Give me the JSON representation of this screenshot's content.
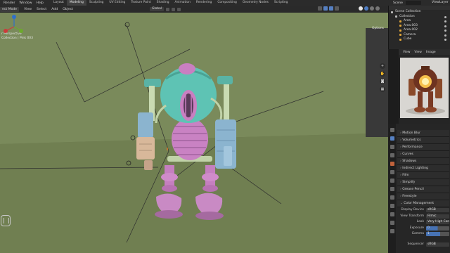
{
  "menu": {
    "items": [
      "Render",
      "Window",
      "Help"
    ],
    "workspace_tabs": [
      "Layout",
      "Modeling",
      "Sculpting",
      "UV Editing",
      "Texture Paint",
      "Shading",
      "Animation",
      "Rendering",
      "Compositing",
      "Geometry Nodes",
      "Scripting"
    ],
    "active_tab": "Modeling",
    "scene_label": "Scene",
    "view_layer_label": "ViewLayer"
  },
  "viewport_header": {
    "mode": "ect Mode",
    "menus": [
      "View",
      "Select",
      "Add",
      "Object"
    ],
    "orientation": "Global",
    "options_label": "Options"
  },
  "viewport_info": {
    "line1": "r Perspective",
    "line2": "Collection | Pink 003"
  },
  "outliner": {
    "rows": [
      {
        "label": "Scene Collection",
        "color": "#d0d0d0"
      },
      {
        "label": "Collection",
        "color": "#d0d0d0"
      },
      {
        "label": "Area",
        "color": "#e0a63a"
      },
      {
        "label": "Area.003",
        "color": "#e0a63a"
      },
      {
        "label": "Area.002",
        "color": "#e0a63a"
      },
      {
        "label": "Camera",
        "color": "#e0a63a"
      },
      {
        "label": "Cube",
        "color": "#e0a63a"
      }
    ]
  },
  "image_panel": {
    "menus": [
      "View",
      "View",
      "Image"
    ]
  },
  "properties": {
    "sections": [
      "Motion Blur",
      "Volumetrics",
      "Performance",
      "Curves",
      "Shadows",
      "Indirect Lighting",
      "Film",
      "Simplify",
      "Grease Pencil",
      "Freestyle"
    ],
    "open_section": "Color Management",
    "fields": [
      {
        "label": "Display Device",
        "value": "sRGB"
      },
      {
        "label": "View Transform",
        "value": "Filmic"
      },
      {
        "label": "Look",
        "value": "Very High Con"
      },
      {
        "label": "Exposure",
        "value": "0"
      },
      {
        "label": "Gamma",
        "value": "1"
      }
    ],
    "sequencer": {
      "label": "Sequencer",
      "value": "sRGB"
    }
  }
}
